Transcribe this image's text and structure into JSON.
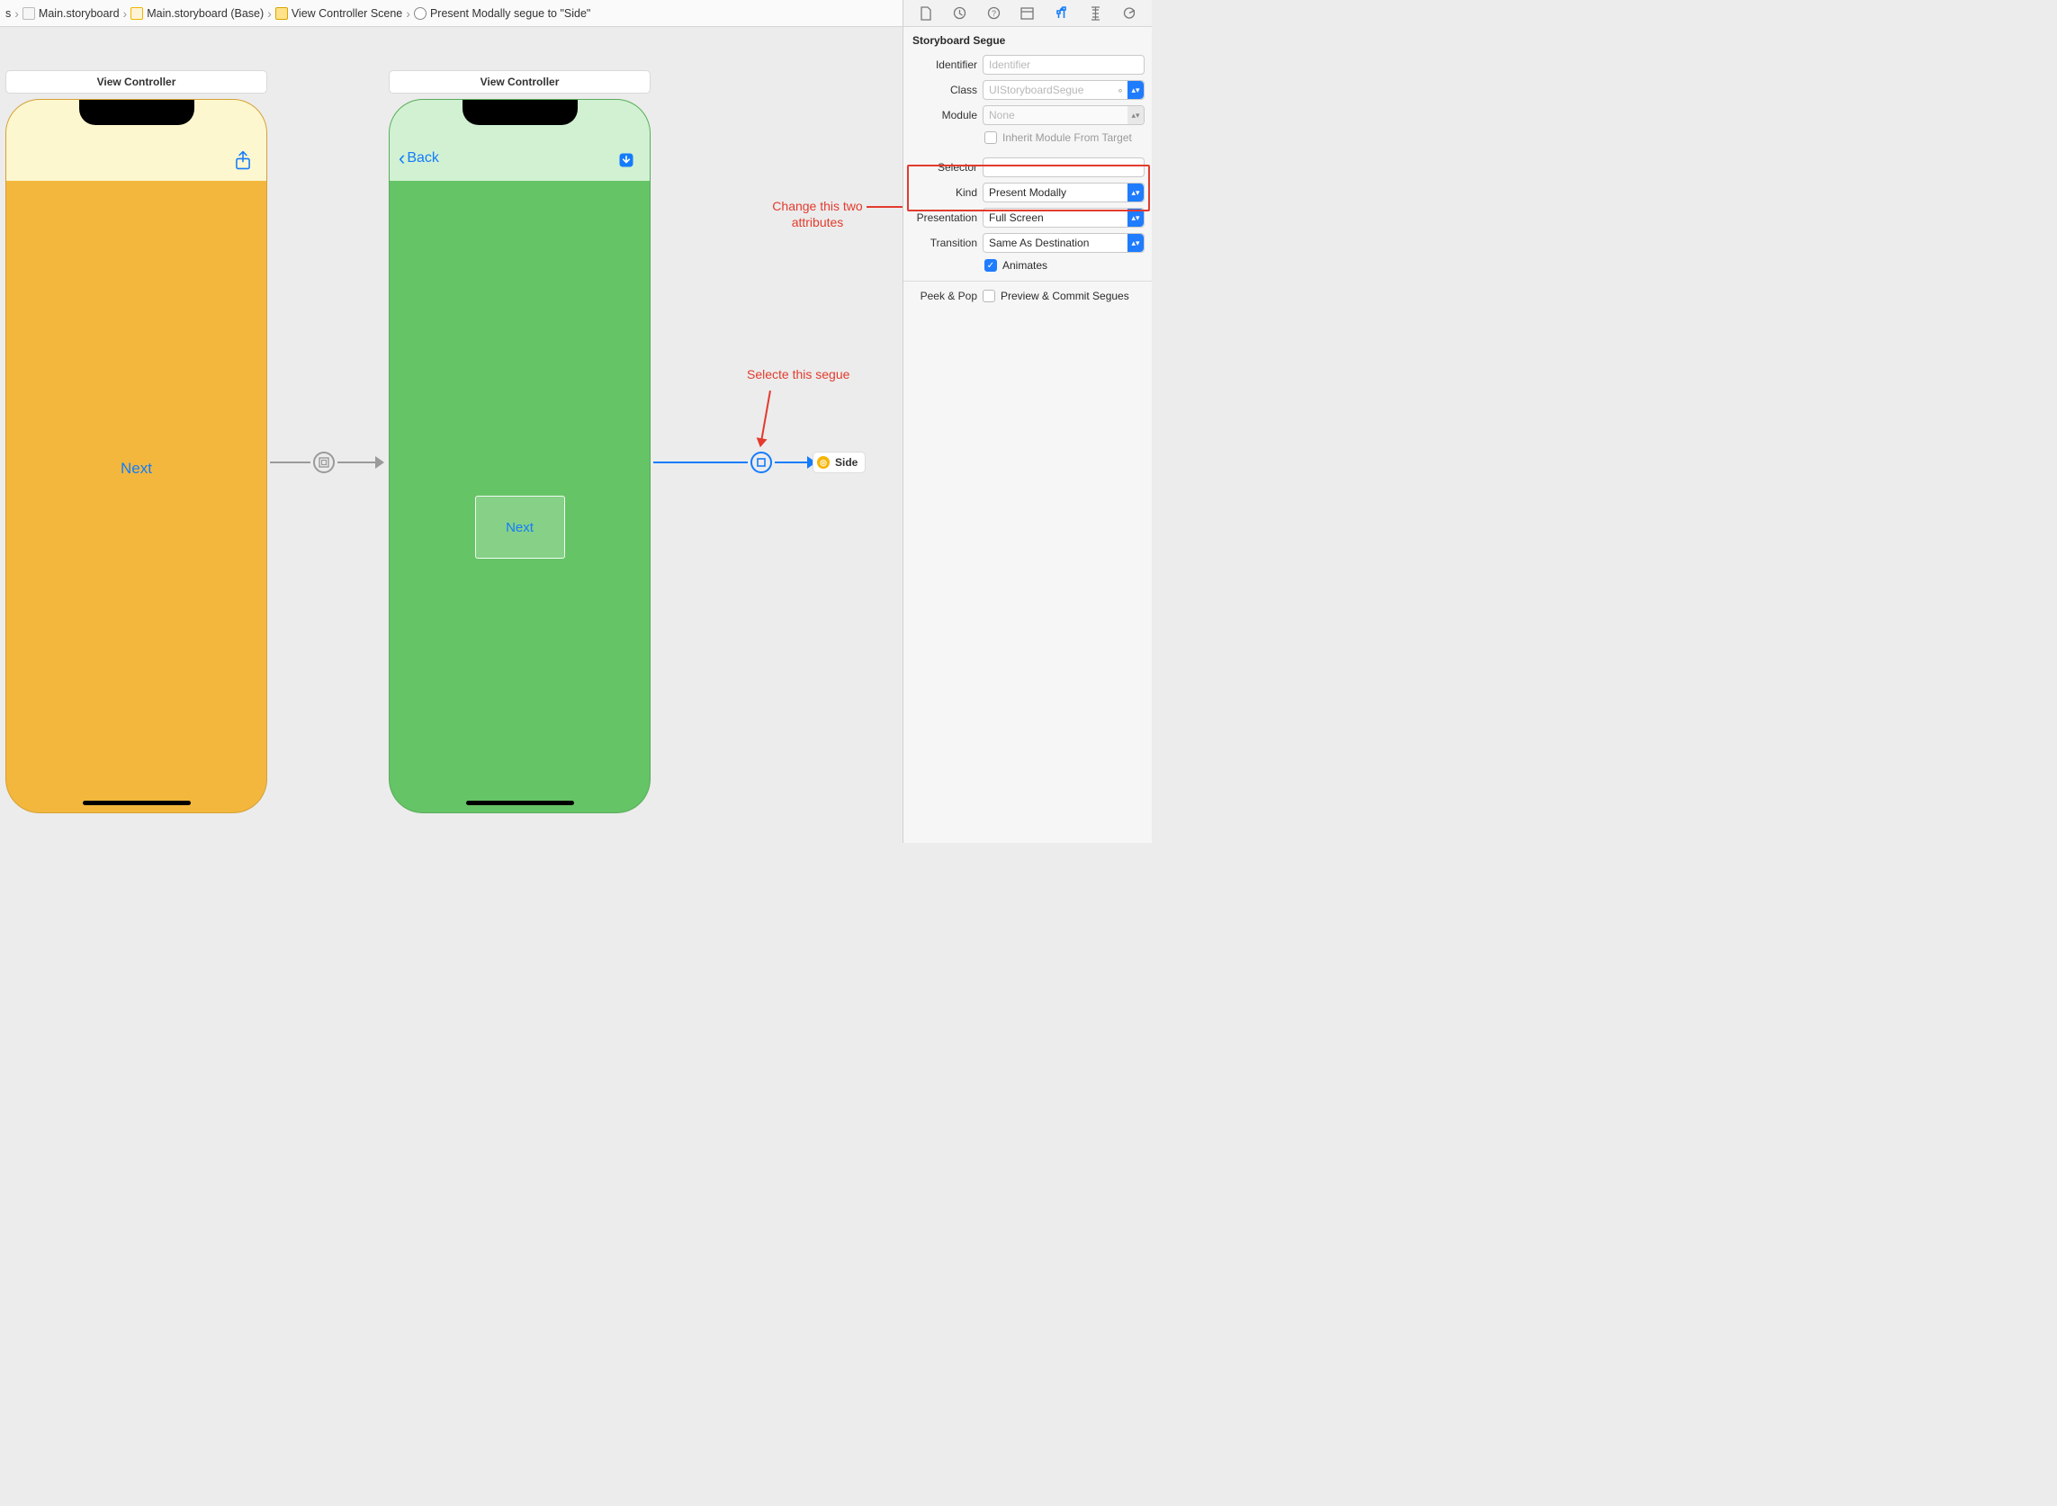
{
  "breadcrumb": {
    "item0_suffix": "s",
    "item1": "Main.storyboard",
    "item2": "Main.storyboard (Base)",
    "item3": "View Controller Scene",
    "item4": "Present Modally segue to \"Side\""
  },
  "canvas": {
    "vc1_title": "View Controller",
    "vc2_title": "View Controller",
    "vc1_button": "Next",
    "vc2_back": "Back",
    "vc2_button": "Next",
    "side_chip": "Side"
  },
  "annotations": {
    "change_attrs_l1": "Change this two",
    "change_attrs_l2": "attributes",
    "select_segue": "Selecte this segue"
  },
  "inspector": {
    "section": "Storyboard Segue",
    "labels": {
      "identifier": "Identifier",
      "klass": "Class",
      "module": "Module",
      "inherit": "Inherit Module From Target",
      "selector": "Selector",
      "kind": "Kind",
      "presentation": "Presentation",
      "transition": "Transition",
      "animates": "Animates",
      "peek": "Peek & Pop",
      "preview": "Preview & Commit Segues"
    },
    "values": {
      "identifier_placeholder": "Identifier",
      "klass": "UIStoryboardSegue",
      "module": "None",
      "selector": "",
      "kind": "Present Modally",
      "presentation": "Full Screen",
      "transition": "Same As Destination"
    },
    "checks": {
      "inherit": false,
      "animates": true,
      "preview": false
    }
  }
}
